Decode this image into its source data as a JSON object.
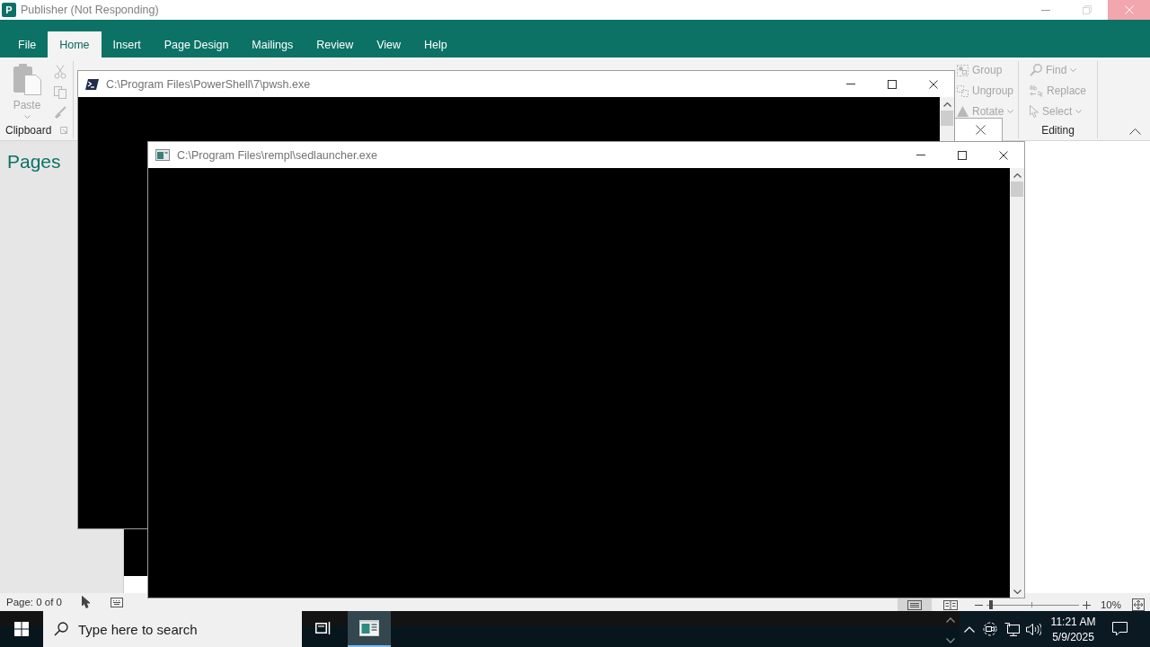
{
  "publisher_window": {
    "logo_letter": "P",
    "title": "Publisher (Not Responding)"
  },
  "ribbon_tabs": [
    {
      "label": "File",
      "selected": false
    },
    {
      "label": "Home",
      "selected": true
    },
    {
      "label": "Insert",
      "selected": false
    },
    {
      "label": "Page Design",
      "selected": false
    },
    {
      "label": "Mailings",
      "selected": false
    },
    {
      "label": "Review",
      "selected": false
    },
    {
      "label": "View",
      "selected": false
    },
    {
      "label": "Help",
      "selected": false
    }
  ],
  "ribbon": {
    "clipboard": {
      "paste": {
        "label": "Paste",
        "disabled": true
      },
      "label": "Clipboard"
    },
    "arrange": [
      {
        "label": "Group",
        "disabled": true,
        "dropdown": false
      },
      {
        "label": "Ungroup",
        "disabled": true,
        "dropdown": false
      },
      {
        "label": "Rotate",
        "disabled": true,
        "dropdown": true
      }
    ],
    "editing": {
      "items": [
        {
          "label": "Find",
          "disabled": true,
          "dropdown": true
        },
        {
          "label": "Replace",
          "disabled": true,
          "dropdown": false
        },
        {
          "label": "Select",
          "disabled": true,
          "dropdown": true
        }
      ],
      "label": "Editing"
    }
  },
  "pages_panel": {
    "title": "Pages"
  },
  "status_bar": {
    "page_info": "Page: 0 of 0",
    "view_buttons": [
      {
        "kind": "single-page",
        "selected": true
      },
      {
        "kind": "two-page",
        "selected": false
      }
    ],
    "zoom_slider": {
      "level": 0.03
    },
    "zoom": "10%"
  },
  "console_windows": [
    {
      "kind": "powershell",
      "title": "C:\\Program Files\\PowerShell\\7\\pwsh.exe"
    },
    {
      "kind": "console",
      "title": "C:\\Program Files\\rempl\\sedlauncher.exe"
    }
  ],
  "taskbar": {
    "search": {
      "placeholder": "Type here to search"
    },
    "apps": [
      {
        "kind": "task-view",
        "selected": false
      },
      {
        "kind": "publisher",
        "selected": true
      }
    ],
    "clock": {
      "time": "11:21 AM",
      "date": "5/9/2025"
    }
  }
}
